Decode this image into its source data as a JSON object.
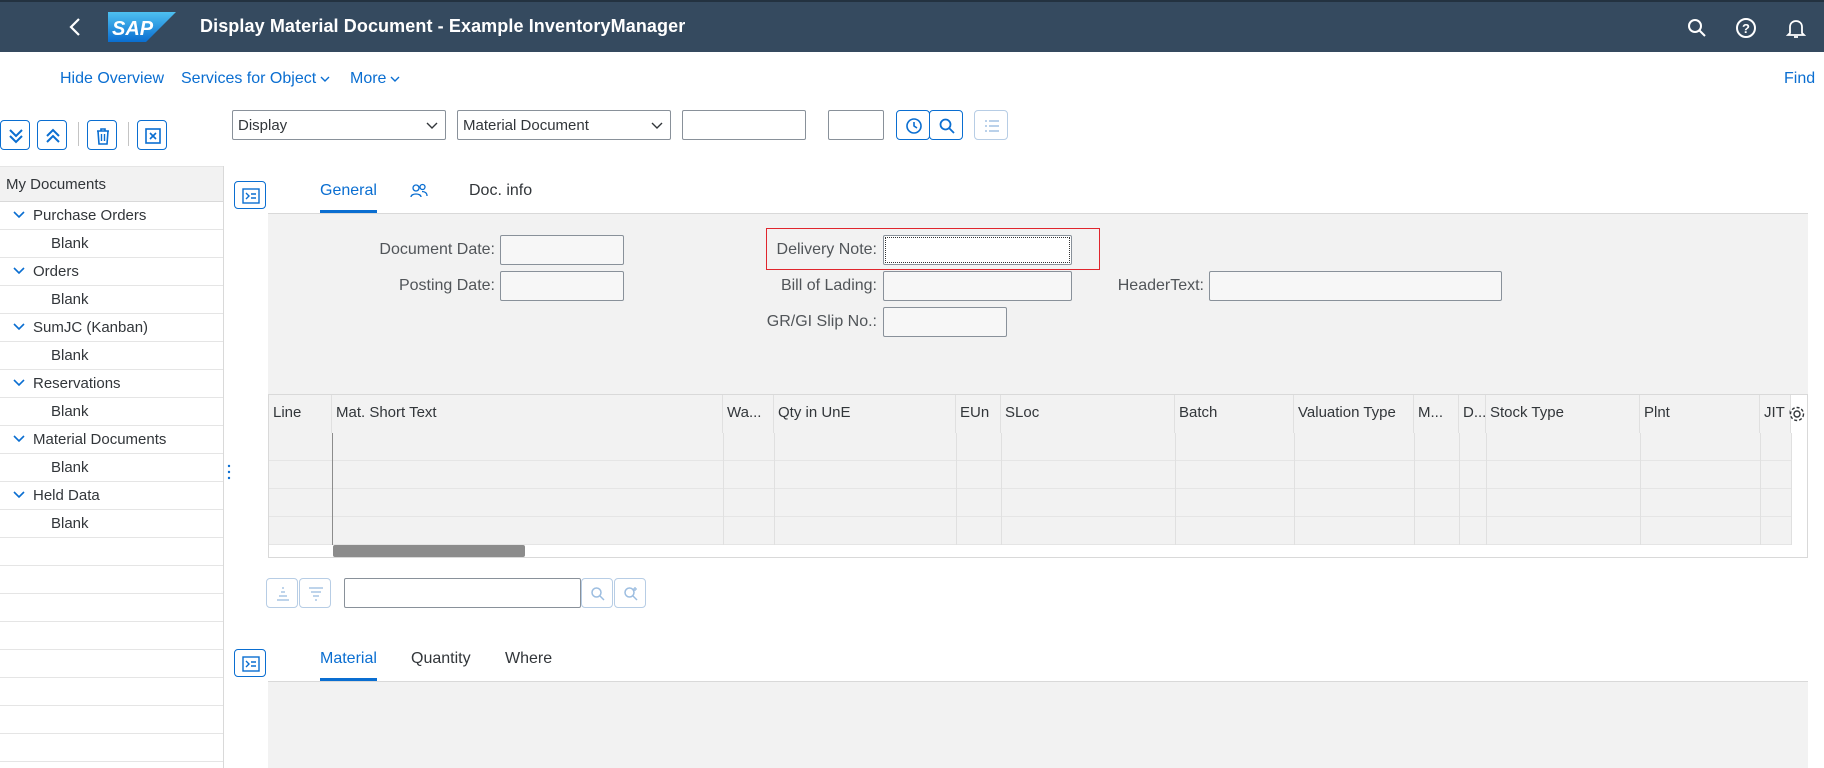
{
  "shell": {
    "title": "Display Material Document - Example InventoryManager",
    "logo_text": "SAP",
    "icons": [
      "back-icon",
      "search-icon",
      "help-icon",
      "bell-icon"
    ]
  },
  "subbar": {
    "hide_overview": "Hide Overview",
    "services": "Services for Object",
    "more": "More",
    "find": "Find"
  },
  "tree": {
    "header": "My Documents",
    "groups": [
      {
        "label": "Purchase Orders",
        "child": "Blank"
      },
      {
        "label": "Orders",
        "child": "Blank"
      },
      {
        "label": "SumJC (Kanban)",
        "child": "Blank"
      },
      {
        "label": "Reservations",
        "child": "Blank"
      },
      {
        "label": "Material Documents",
        "child": "Blank"
      },
      {
        "label": "Held Data",
        "child": "Blank"
      }
    ]
  },
  "selectors": {
    "action": "Display",
    "object": "Material Document",
    "doc_number": "",
    "year": ""
  },
  "header_tabs": {
    "general": "General",
    "partners": "",
    "doc_info": "Doc. info"
  },
  "form": {
    "document_date_label": "Document Date:",
    "document_date": "",
    "posting_date_label": "Posting Date:",
    "posting_date": "",
    "delivery_note_label": "Delivery Note:",
    "delivery_note": "",
    "bill_of_lading_label": "Bill of Lading:",
    "bill_of_lading": "",
    "slip_label": "GR/GI Slip No.:",
    "slip": "",
    "header_text_label": "HeaderText:",
    "header_text": ""
  },
  "table": {
    "columns": [
      "Line",
      "Mat. Short Text",
      "Wa...",
      "Qty in UnE",
      "EUn",
      "SLoc",
      "Batch",
      "Valuation Type",
      "M...",
      "D...",
      "Stock Type",
      "Plnt",
      "JIT C"
    ],
    "rows": 4
  },
  "item_search": {
    "value": ""
  },
  "item_tabs": {
    "material": "Material",
    "quantity": "Quantity",
    "where": "Where"
  },
  "colors": {
    "shell": "#354a5f",
    "accent": "#0a6ed1",
    "focus_highlight": "#e0262d"
  }
}
